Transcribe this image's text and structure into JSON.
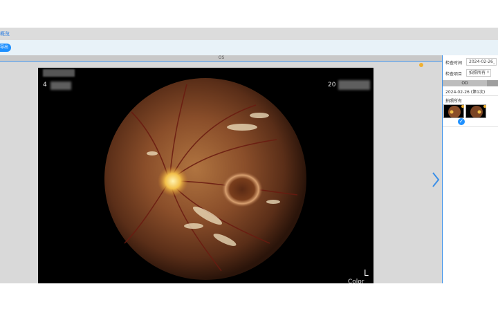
{
  "header": {
    "tab_link": "概览"
  },
  "toolbar": {
    "button_label": "导出"
  },
  "viewer": {
    "title": "OS",
    "overlay": {
      "patient_id_prefix": "4",
      "date_prefix": "20",
      "eye": "L",
      "mode": "Color"
    }
  },
  "panel": {
    "exam_time_label": "检查时间",
    "exam_time_value": "2024-02-26_",
    "filter_label": "检查项目",
    "filter_value": "拍照所有",
    "filter_clear": "×",
    "column_header": "OD",
    "exam_date_row": "2024-02-26 (第1次)",
    "group_label": "拍照所有",
    "check_mark": "✓"
  },
  "colors": {
    "accent": "#1e90ff",
    "border_blue": "#3a8fe8",
    "marker_orange": "#f0b030"
  },
  "icons": {
    "next": "chevron-right-icon",
    "check": "check-circle-icon"
  }
}
